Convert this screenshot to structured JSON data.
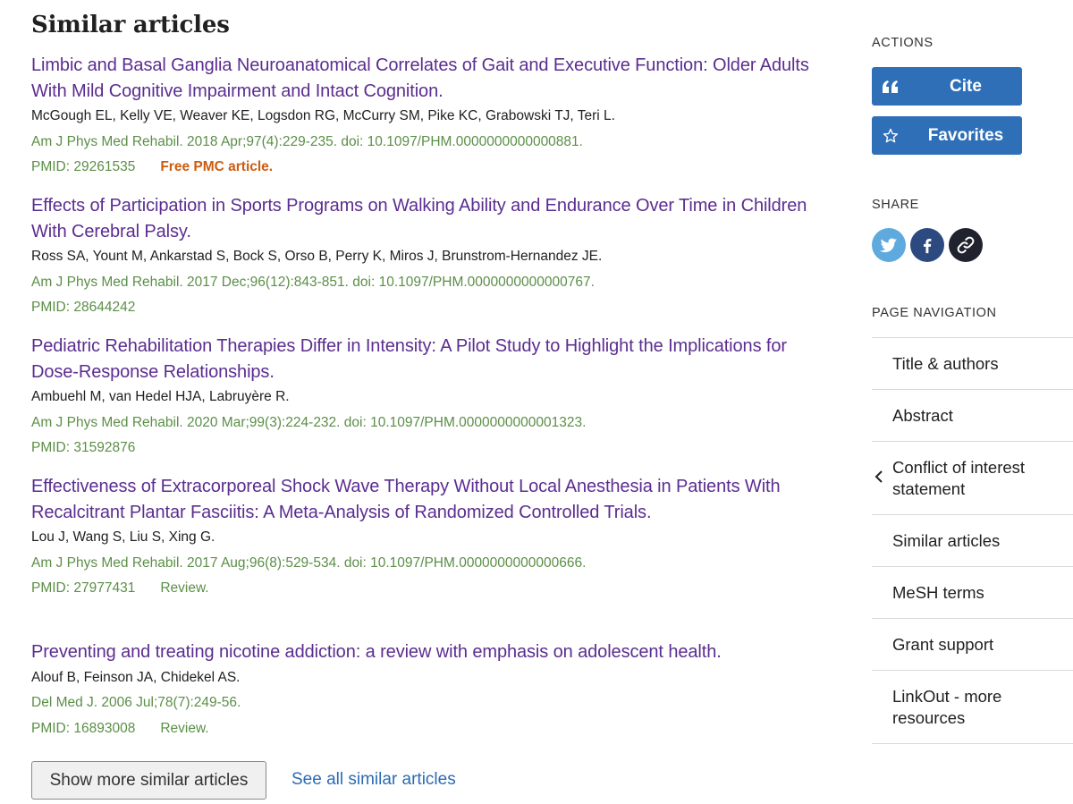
{
  "section_title": "Similar articles",
  "articles": [
    {
      "title": "Limbic and Basal Ganglia Neuroanatomical Correlates of Gait and Executive Function: Older Adults With Mild Cognitive Impairment and Intact Cognition.",
      "authors": "McGough EL, Kelly VE, Weaver KE, Logsdon RG, McCurry SM, Pike KC, Grabowski TJ, Teri L.",
      "citation": "Am J Phys Med Rehabil. 2018 Apr;97(4):229-235. doi: 10.1097/PHM.0000000000000881.",
      "pmid": "PMID: 29261535",
      "tag": "Free PMC article."
    },
    {
      "title": "Effects of Participation in Sports Programs on Walking Ability and Endurance Over Time in Children With Cerebral Palsy.",
      "authors": "Ross SA, Yount M, Ankarstad S, Bock S, Orso B, Perry K, Miros J, Brunstrom-Hernandez JE.",
      "citation": "Am J Phys Med Rehabil. 2017 Dec;96(12):843-851. doi: 10.1097/PHM.0000000000000767.",
      "pmid": "PMID: 28644242",
      "tag": ""
    },
    {
      "title": "Pediatric Rehabilitation Therapies Differ in Intensity: A Pilot Study to Highlight the Implications for Dose-Response Relationships.",
      "authors": "Ambuehl M, van Hedel HJA, Labruyère R.",
      "citation": "Am J Phys Med Rehabil. 2020 Mar;99(3):224-232. doi: 10.1097/PHM.0000000000001323.",
      "pmid": "PMID: 31592876",
      "tag": ""
    },
    {
      "title": "Effectiveness of Extracorporeal Shock Wave Therapy Without Local Anesthesia in Patients With Recalcitrant Plantar Fasciitis: A Meta-Analysis of Randomized Controlled Trials.",
      "authors": "Lou J, Wang S, Liu S, Xing G.",
      "citation": "Am J Phys Med Rehabil. 2017 Aug;96(8):529-534. doi: 10.1097/PHM.0000000000000666.",
      "pmid": "PMID: 27977431",
      "tag": "Review."
    },
    {
      "title": "Preventing and treating nicotine addiction: a review with emphasis on adolescent health.",
      "authors": "Alouf B, Feinson JA, Chidekel AS.",
      "citation": "Del Med J. 2006 Jul;78(7):249-56.",
      "pmid": "PMID: 16893008",
      "tag": "Review."
    }
  ],
  "show_more_label": "Show more similar articles",
  "see_all_label": "See all similar articles",
  "sidebar": {
    "actions_heading": "ACTIONS",
    "cite_label": "Cite",
    "favorites_label": "Favorites",
    "share_heading": "SHARE",
    "share_icons": [
      "twitter-icon",
      "facebook-icon",
      "link-icon"
    ],
    "nav_heading": "PAGE NAVIGATION",
    "nav_items": [
      "Title & authors",
      "Abstract",
      "Conflict of interest statement",
      "Similar articles",
      "MeSH terms",
      "Grant support",
      "LinkOut - more resources"
    ]
  },
  "colors": {
    "title_link": "#5b2d90",
    "citation": "#5b8f47",
    "free_pmc": "#cd5c0f",
    "button_blue": "#2f6fb8",
    "twitter": "#5ea9dd",
    "facebook": "#2c4a7f",
    "link": "#20232d"
  }
}
